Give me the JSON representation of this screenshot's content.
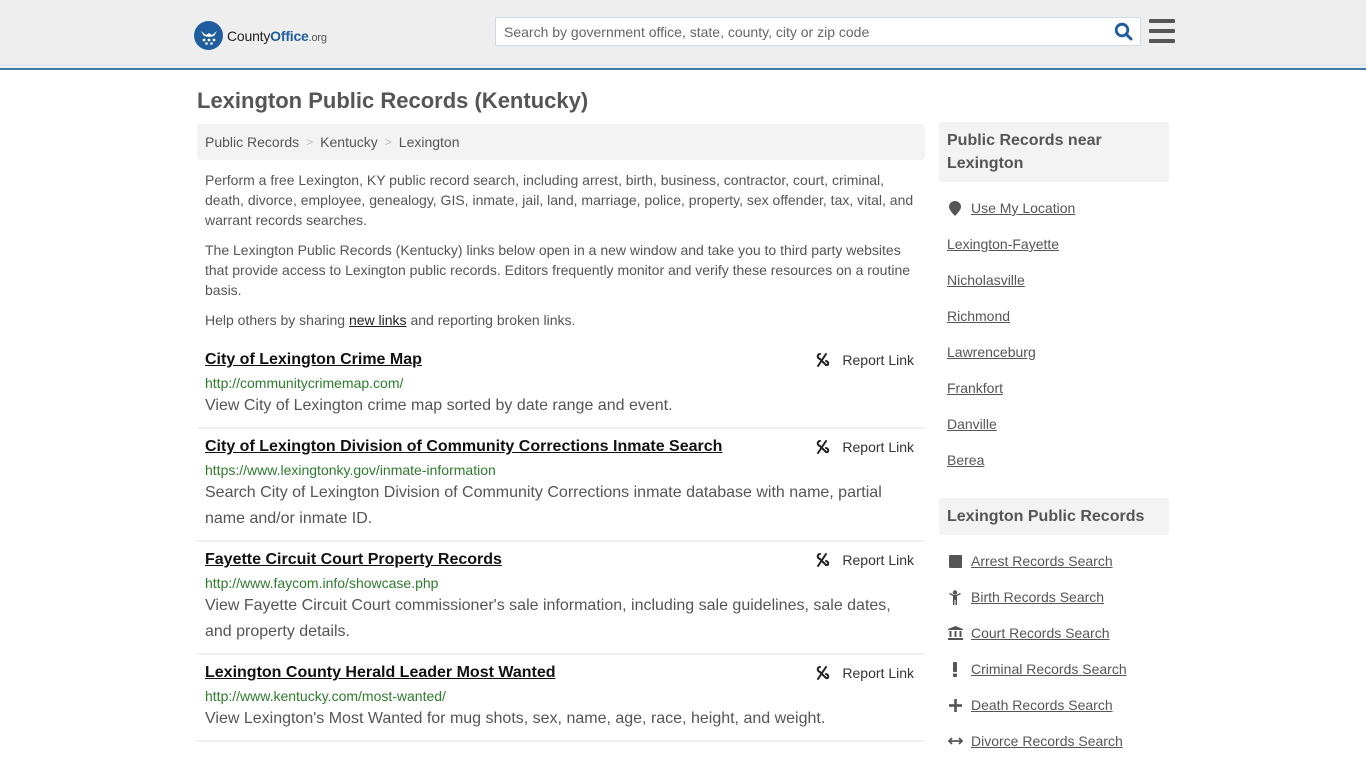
{
  "header": {
    "logo": {
      "county": "County",
      "office": "Office",
      "org": ".org"
    },
    "search_placeholder": "Search by government office, state, county, city or zip code",
    "search_icon": "search-icon",
    "menu_icon": "hamburger-menu-icon"
  },
  "page_title": "Lexington Public Records (Kentucky)",
  "breadcrumb": [
    {
      "label": "Public Records"
    },
    {
      "label": "Kentucky"
    },
    {
      "label": "Lexington"
    }
  ],
  "breadcrumb_separator": ">",
  "intro": {
    "p1": "Perform a free Lexington, KY public record search, including arrest, birth, business, contractor, court, criminal, death, divorce, employee, genealogy, GIS, inmate, jail, land, marriage, police, property, sex offender, tax, vital, and warrant records searches.",
    "p2": "The Lexington Public Records (Kentucky) links below open in a new window and take you to third party websites that provide access to Lexington public records. Editors frequently monitor and verify these resources on a routine basis.",
    "p3_before": "Help others by sharing ",
    "p3_link": "new links",
    "p3_after": " and reporting broken links."
  },
  "report_label": "Report Link",
  "links": [
    {
      "title": "City of Lexington Crime Map",
      "url": "http://communitycrimemap.com/",
      "description": "View City of Lexington crime map sorted by date range and event."
    },
    {
      "title": "City of Lexington Division of Community Corrections Inmate Search",
      "url": "https://www.lexingtonky.gov/inmate-information",
      "description": "Search City of Lexington Division of Community Corrections inmate database with name, partial name and/or inmate ID."
    },
    {
      "title": "Fayette Circuit Court Property Records",
      "url": "http://www.faycom.info/showcase.php",
      "description": "View Fayette Circuit Court commissioner's sale information, including sale guidelines, sale dates, and property details."
    },
    {
      "title": "Lexington County Herald Leader Most Wanted",
      "url": "http://www.kentucky.com/most-wanted/",
      "description": "View Lexington's Most Wanted for mug shots, sex, name, age, race, height, and weight."
    }
  ],
  "sidebar": {
    "nearby_title": "Public Records near Lexington",
    "use_location": "Use My Location",
    "nearby": [
      "Lexington-Fayette",
      "Nicholasville",
      "Richmond",
      "Lawrenceburg",
      "Frankfort",
      "Danville",
      "Berea"
    ],
    "records_title": "Lexington Public Records",
    "records": [
      {
        "label": "Arrest Records Search",
        "icon": "arrest-square-icon",
        "glyph": "■"
      },
      {
        "label": "Birth Records Search",
        "icon": "child-icon",
        "glyph": "♀"
      },
      {
        "label": "Court Records Search",
        "icon": "courthouse-icon",
        "glyph": "🏛"
      },
      {
        "label": "Criminal Records Search",
        "icon": "exclamation-icon",
        "glyph": "!"
      },
      {
        "label": "Death Records Search",
        "icon": "cross-icon",
        "glyph": "✚"
      },
      {
        "label": "Divorce Records Search",
        "icon": "arrows-horizontal-icon",
        "glyph": "↔"
      }
    ]
  }
}
